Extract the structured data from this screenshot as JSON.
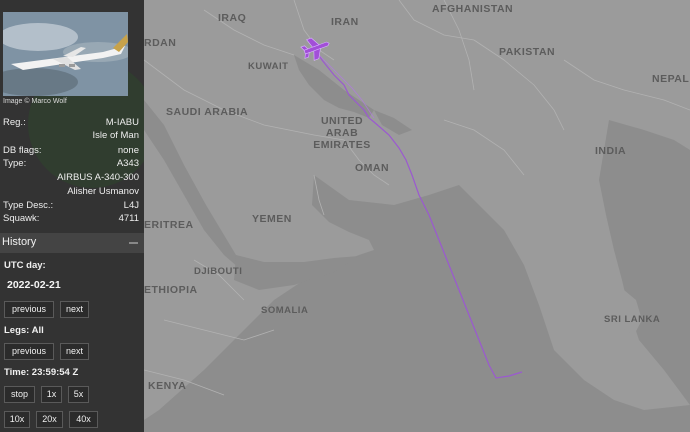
{
  "aircraft": {
    "photo_credit": "Image © Marco Wolf",
    "fields": [
      {
        "key": "Reg.:",
        "value": "M-IABU"
      },
      {
        "key": "",
        "value": "Isle of Man"
      },
      {
        "key": "DB flags:",
        "value": "none"
      },
      {
        "key": "Type:",
        "value": "A343"
      },
      {
        "key": "",
        "value": "AIRBUS A-340-300"
      },
      {
        "key": "",
        "value": "Alisher Usmanov"
      },
      {
        "key": "Type Desc.:",
        "value": "L4J"
      },
      {
        "key": "Squawk:",
        "value": "4711"
      }
    ]
  },
  "history": {
    "title": "History",
    "utc_day_label": "UTC day:",
    "utc_day_value": "2022-02-21",
    "previous_label": "previous",
    "next_label": "next",
    "legs_label": "Legs: All",
    "legs_previous_label": "previous",
    "legs_next_label": "next",
    "time_label": "Time: 23:59:54 Z",
    "playback_buttons": [
      "stop",
      "1x",
      "5x",
      "10x",
      "20x",
      "40x"
    ]
  },
  "map": {
    "labels": {
      "iraq": "IRAQ",
      "iran": "IRAN",
      "afghanistan": "AFGHANISTAN",
      "pakistan": "PAKISTAN",
      "nepal": "NEPAL",
      "jordan": "RDAN",
      "kuwait": "KUWAIT",
      "saudi": "SAUDI ARABIA",
      "uae": "UNITED\nARAB\nEMIRATES",
      "india": "INDIA",
      "oman": "OMAN",
      "eritrea": "ERITREA",
      "yemen": "YEMEN",
      "djibouti": "DJIBOUTI",
      "ethiopia": "ETHIOPIA",
      "somalia": "SOMALIA",
      "srilanka": "SRI LANKA",
      "kenya": "KENYA"
    },
    "track_color": "#9b59d0",
    "aircraft_color": "#a24fd8"
  }
}
